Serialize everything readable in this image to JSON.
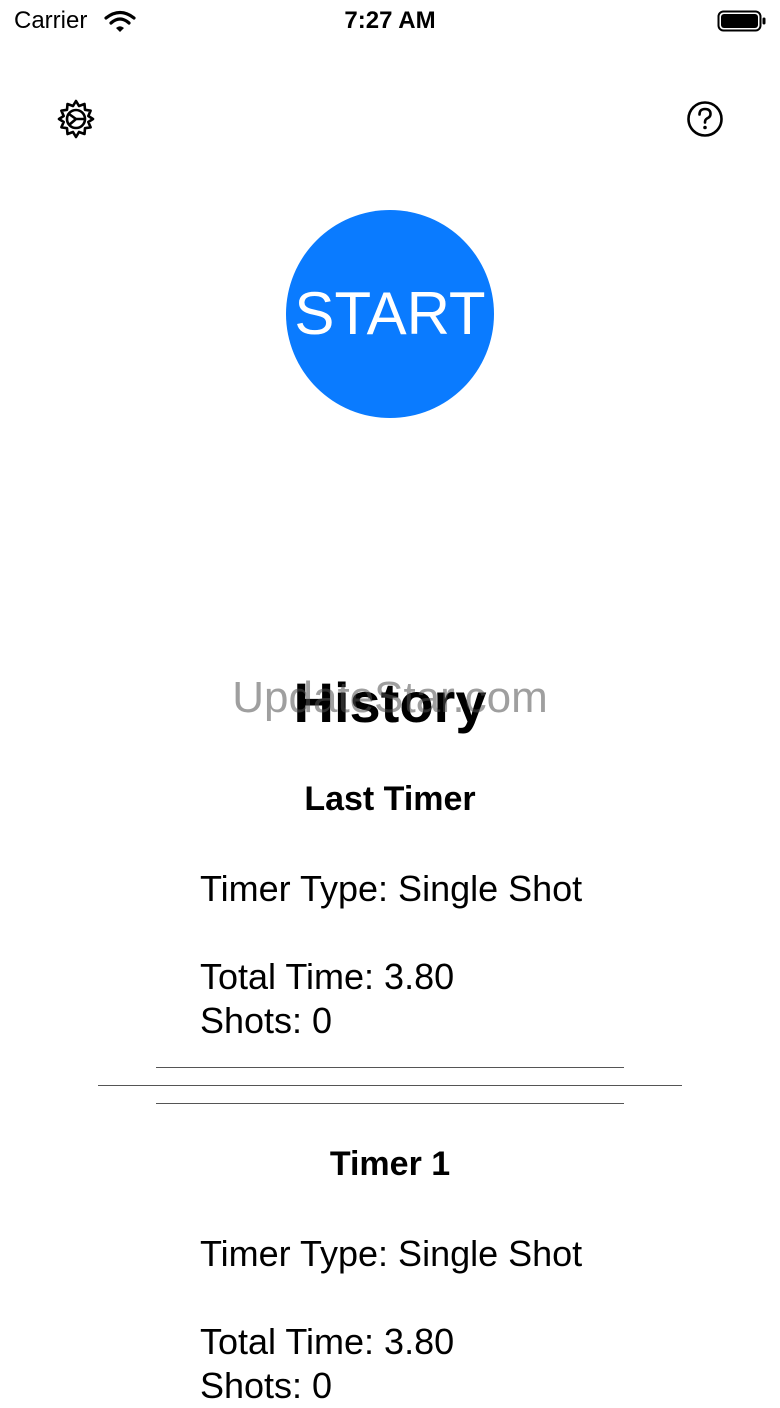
{
  "status_bar": {
    "carrier": "Carrier",
    "time": "7:27 AM"
  },
  "toolbar": {
    "settings_icon": "gear-icon",
    "help_icon": "question-circle-icon"
  },
  "start_button": {
    "label": "START",
    "color": "#0a7bff"
  },
  "watermark": "UpdateStar.com",
  "history": {
    "title": "History",
    "last_timer": {
      "title": "Last Timer",
      "timer_type": "Timer Type: Single Shot",
      "total_time": "Total Time: 3.80",
      "shots": "Shots: 0"
    },
    "entries": [
      {
        "title": "Timer 1",
        "timer_type": "Timer Type: Single Shot",
        "total_time": "Total Time: 3.80",
        "shots": "Shots: 0"
      }
    ]
  }
}
